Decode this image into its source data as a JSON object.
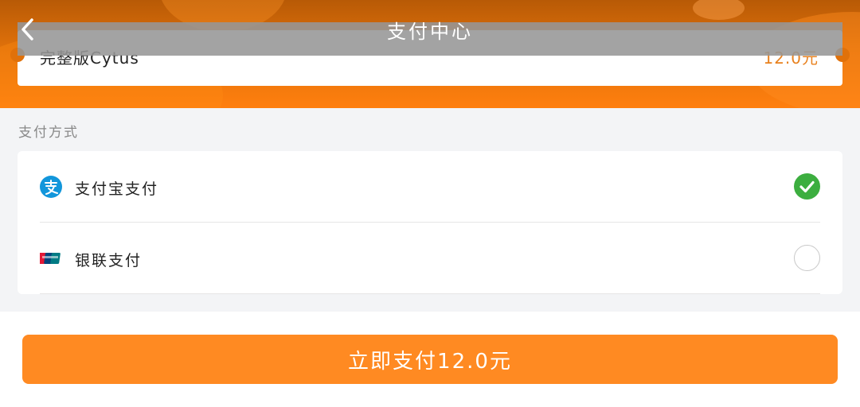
{
  "header": {
    "title": "支付中心"
  },
  "product": {
    "name": "完整版Cytus",
    "price": "12.0元"
  },
  "payment": {
    "section_label": "支付方式",
    "methods": [
      {
        "label": "支付宝支付",
        "icon": "alipay-icon",
        "selected": true
      },
      {
        "label": "银联支付",
        "icon": "unionpay-icon",
        "selected": false
      }
    ]
  },
  "footer": {
    "pay_button_label": "立即支付12.0元"
  },
  "colors": {
    "accent": "#ff8a22",
    "banner": "#e0710a",
    "price": "#e8811e",
    "check": "#3cae3f",
    "alipay": "#1296db"
  },
  "icons": {
    "back": "chevron-left-icon",
    "selected": "check-circle-icon",
    "unselected": "radio-empty-icon"
  }
}
